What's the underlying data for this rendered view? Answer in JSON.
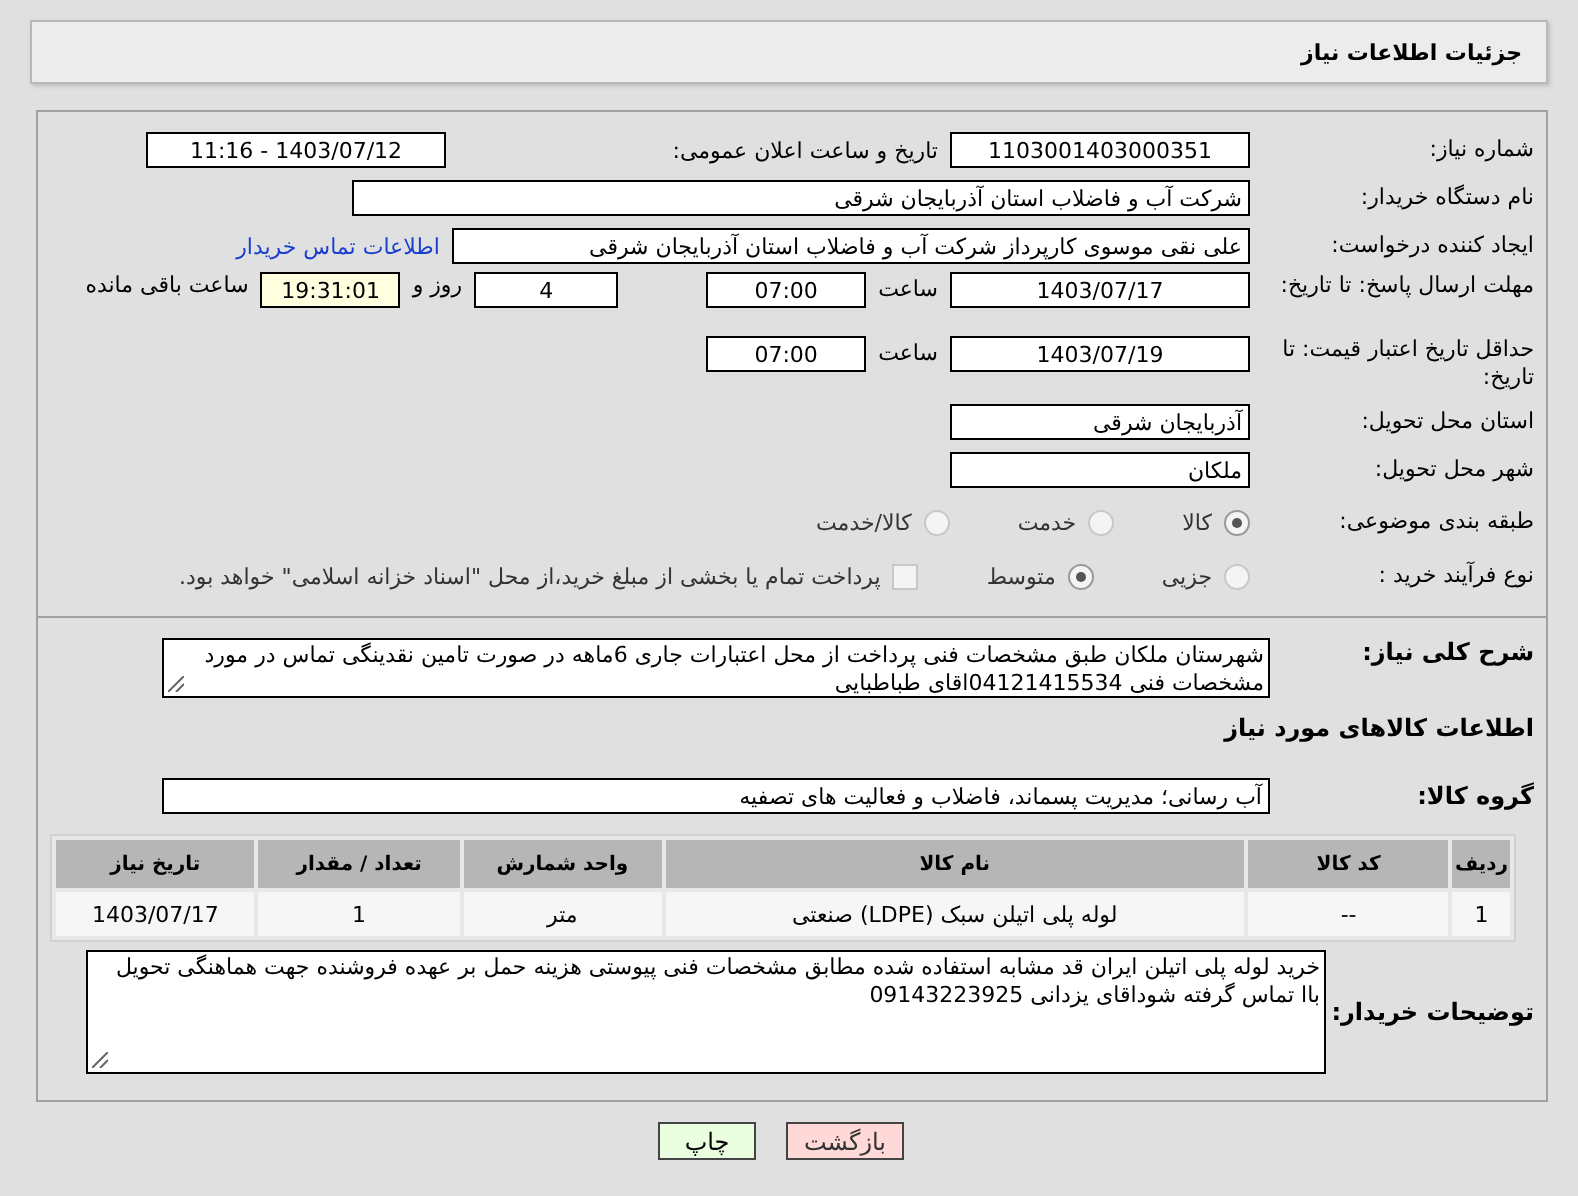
{
  "page_title": "جزئیات اطلاعات نیاز",
  "need_number": {
    "label": "شماره نیاز:",
    "value": "1103001403000351"
  },
  "announce": {
    "label": "تاریخ و ساعت اعلان عمومی:",
    "value": "1403/07/12 - 11:16"
  },
  "buyer_org": {
    "label": "نام دستگاه خریدار:",
    "value": "شرکت آب و فاضلاب استان آذربایجان شرقی"
  },
  "requester": {
    "label": "ایجاد کننده درخواست:",
    "value": "علی نقی موسوی کارپرداز شرکت آب و فاضلاب استان آذربایجان شرقی",
    "link": "اطلاعات تماس خریدار"
  },
  "reply_deadline": {
    "label": "مهلت ارسال پاسخ: تا تاریخ:",
    "date": "1403/07/17",
    "time_label": "ساعت",
    "time": "07:00",
    "days": "4",
    "days_label": "روز و",
    "remaining": "19:31:01",
    "remaining_label": "ساعت باقی مانده"
  },
  "price_validity": {
    "label": "حداقل تاریخ اعتبار قیمت: تا تاریخ:",
    "date": "1403/07/19",
    "time_label": "ساعت",
    "time": "07:00"
  },
  "province": {
    "label": "استان محل تحویل:",
    "value": "آذربایجان شرقی"
  },
  "city": {
    "label": "شهر محل تحویل:",
    "value": "ملکان"
  },
  "category": {
    "label": "طبقه بندی موضوعی:",
    "options": [
      {
        "label": "کالا",
        "selected": true
      },
      {
        "label": "خدمت",
        "selected": false
      },
      {
        "label": "کالا/خدمت",
        "selected": false
      }
    ]
  },
  "purchase_process": {
    "label": "نوع فرآیند خرید :",
    "options": [
      {
        "label": "جزیی",
        "selected": false
      },
      {
        "label": "متوسط",
        "selected": true
      }
    ],
    "treasury": {
      "checked": false,
      "text": "پرداخت تمام یا بخشی از مبلغ خرید،از محل \"اسناد خزانه اسلامی\" خواهد بود."
    }
  },
  "description": {
    "label": "شرح کلی نیاز:",
    "value": "شهرستان ملکان طبق مشخصات فنی پرداخت از محل اعتبارات جاری     6ماهه در صورت تامین نقدینگی تماس در مورد مشخصات فنی 04121415534اقای  طباطبایی"
  },
  "goods_heading": "اطلاعات کالاهای مورد نیاز",
  "goods_group": {
    "label": "گروه کالا:",
    "value": "آب رسانی؛ مدیریت پسماند، فاضلاب و فعالیت های تصفیه"
  },
  "table": {
    "columns": [
      "ردیف",
      "کد کالا",
      "نام کالا",
      "واحد شمارش",
      "تعداد / مقدار",
      "تاریخ نیاز"
    ],
    "rows": [
      [
        "1",
        "--",
        "لوله پلی اتیلن سبک (LDPE) صنعتی",
        "متر",
        "1",
        "1403/07/17"
      ]
    ]
  },
  "buyer_notes": {
    "label": "توضیحات خریدار:",
    "value": "خرید لوله پلی اتیلن ایران قد مشابه استفاده شده مطابق مشخصات فنی پیوستی  هزینه حمل بر عهده فروشنده جهت هماهنگی تحویل باا تماس گرفته شوداقای یزدانی 09143223925"
  },
  "buttons": [
    {
      "label": "بازگشت",
      "kind": "back"
    },
    {
      "label": "چاپ",
      "kind": "print"
    }
  ]
}
